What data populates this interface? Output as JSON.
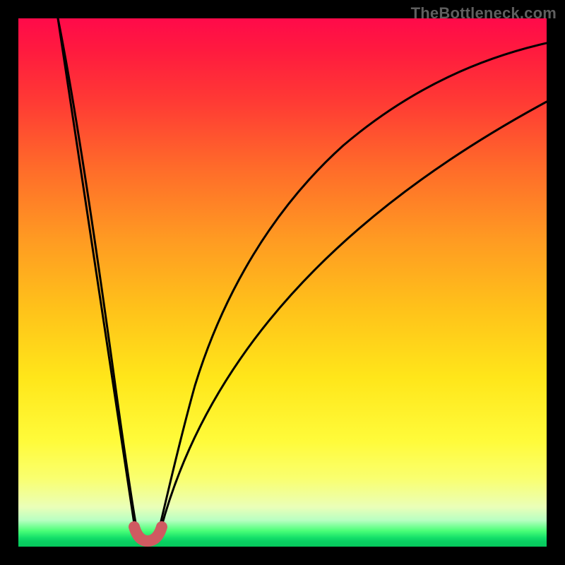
{
  "watermark": "TheBottleneck.com",
  "colors": {
    "background": "#000000",
    "curve": "#000000",
    "marker": "#cf5a61",
    "gradient_top": "#ff0a4a",
    "gradient_bottom": "#06c85c"
  },
  "chart_data": {
    "type": "line",
    "title": "",
    "xlabel": "",
    "ylabel": "",
    "xlim": [
      0,
      100
    ],
    "ylim": [
      0,
      100
    ],
    "grid": false,
    "legend": false,
    "note": "Values read off the figure by visual proportion; no axis ticks or labels are present in the image.",
    "series": [
      {
        "name": "left-branch",
        "x": [
          7.5,
          8.5,
          10,
          11.5,
          13,
          14.5,
          16,
          17.5,
          19,
          20.5,
          22
        ],
        "y": [
          100,
          92,
          80,
          68,
          57,
          46,
          36,
          27,
          18,
          10,
          3
        ]
      },
      {
        "name": "right-branch",
        "x": [
          27,
          29,
          32,
          36,
          40,
          45,
          51,
          58,
          66,
          75,
          85,
          95,
          100
        ],
        "y": [
          3,
          10,
          20,
          30,
          38,
          46,
          53,
          60,
          66,
          72,
          77,
          82,
          84
        ]
      },
      {
        "name": "minimum-marker",
        "x": [
          22,
          22.8,
          24.5,
          26.2,
          27
        ],
        "y": [
          3.3,
          1.4,
          1.0,
          1.4,
          3.3
        ]
      }
    ],
    "minimum": {
      "x": 24.5,
      "y": 1.0
    }
  }
}
